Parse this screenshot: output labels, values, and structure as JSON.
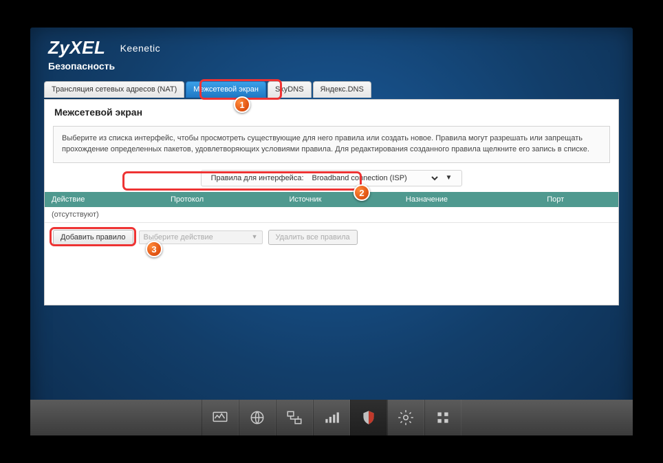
{
  "brand": {
    "name": "ZyXEL",
    "model": "Keenetic"
  },
  "breadcrumb": "Безопасность",
  "tabs": [
    {
      "label": "Трансляция сетевых адресов (NAT)"
    },
    {
      "label": "Межсетевой экран"
    },
    {
      "label": "SkyDNS"
    },
    {
      "label": "Яндекс.DNS"
    }
  ],
  "page": {
    "title": "Межсетевой экран",
    "hint": "Выберите из списка интерфейс, чтобы просмотреть существующие для него правила или создать новое. Правила могут разрешать или запрещать прохождение определенных пакетов, удовлетворяющих условиями правила. Для редактирования созданного правила щелкните его запись в списке.",
    "iface_label": "Правила для интерфейса:",
    "iface_value": "Broadband connection (ISP)",
    "grid_headers": [
      "Действие",
      "Протокол",
      "Источник",
      "Назначение",
      "Порт"
    ],
    "grid_empty": "(отсутствуют)",
    "btn_add": "Добавить правило",
    "sel_hint": "Выберите действие",
    "btn_delall": "Удалить все правила"
  },
  "callouts": {
    "n1": "1",
    "n2": "2",
    "n3": "3"
  },
  "dock_icons": [
    "chart",
    "globe",
    "net",
    "bars",
    "shield",
    "gear",
    "grid"
  ]
}
